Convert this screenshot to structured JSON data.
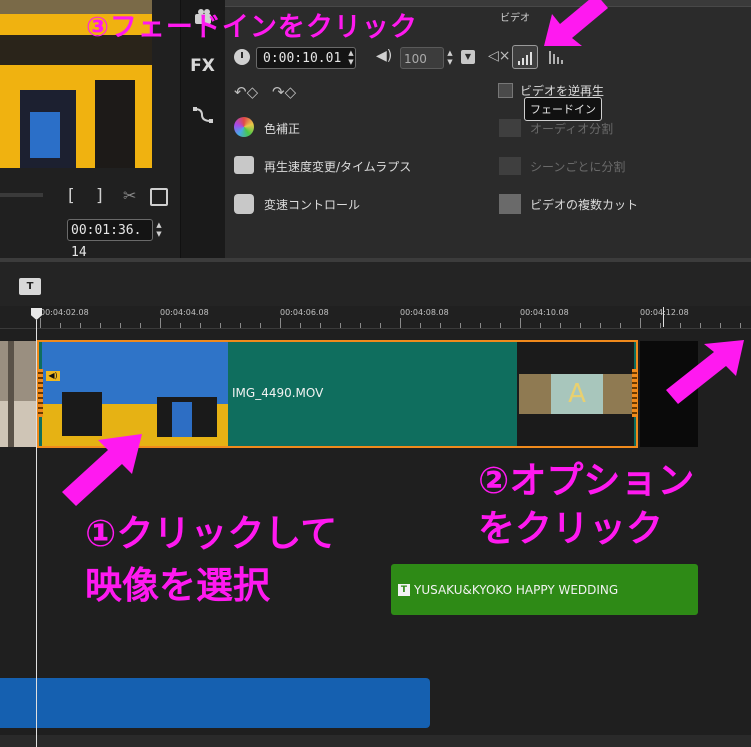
{
  "preview": {
    "bracket_in": "[",
    "bracket_out": "]",
    "timecode": "00:01:36. 14"
  },
  "sidebar": {
    "fx_label": "FX"
  },
  "options": {
    "video_header": "ビデオ",
    "duration": "0:00:10.01",
    "volume": "100",
    "reverse_label": "ビデオを逆再生",
    "tooltip": "フェードイン",
    "color_label": "色補正",
    "speed_label": "再生速度変更/タイムラプス",
    "varspeed_label": "変速コントロール",
    "audio_split_label": "オーディオ分割",
    "scene_split_label": "シーンごとに分割",
    "multicut_label": "ビデオの複数カット"
  },
  "timeline": {
    "title_track_icon": "T",
    "ruler_ticks": [
      "00:04:02.08",
      "00:04:04.08",
      "00:04:06.08",
      "00:04:08.08",
      "00:04:10.08",
      "00:04:12.08"
    ],
    "clip_name": "IMG_4490.MOV",
    "audio_badge": "◀)",
    "title_clip_icon": "T",
    "title_clip_label": "YUSAKU&KYOKO HAPPY WEDDING"
  },
  "annotations": {
    "step3": "③フェードインをクリック",
    "step2_line1": "②オプション",
    "step2_line2": "をクリック",
    "step1_line1": "①クリックして",
    "step1_line2": "映像を選択"
  },
  "colors": {
    "annotation": "#ff19f0",
    "clip_selected_border": "#f08a1c",
    "clip_body": "#0f6e5e",
    "title_clip": "#2e8a16",
    "music_clip": "#1560b0"
  },
  "icons": [
    "camera-icon",
    "fx-icon",
    "path-icon",
    "clock-icon",
    "speaker-icon",
    "mute-icon",
    "fadein-icon",
    "fadeout-icon",
    "rotate-left-icon",
    "rotate-right-icon",
    "color-icon",
    "speed-icon",
    "varspeed-icon",
    "audio-split-icon",
    "scene-split-icon",
    "multicut-icon",
    "cut-icon",
    "copy-icon",
    "title-track-icon"
  ]
}
